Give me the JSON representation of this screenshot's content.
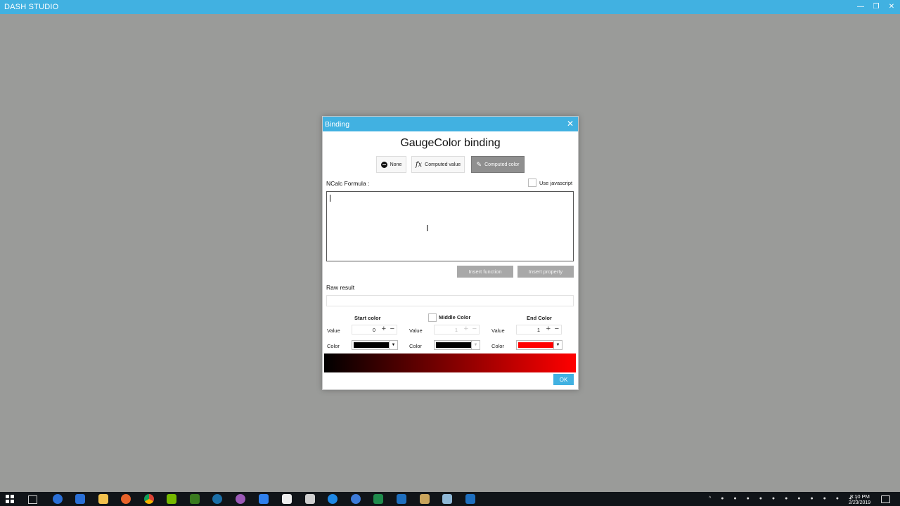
{
  "app": {
    "title": "DASH STUDIO",
    "minimize": "—",
    "maximize": "❐",
    "close": "✕"
  },
  "dialog": {
    "title": "Binding",
    "close": "✕",
    "heading": "GaugeColor binding",
    "modes": [
      {
        "label": "None",
        "icon": "none-icon",
        "active": false
      },
      {
        "label": "Computed value",
        "icon": "fx-icon",
        "active": false
      },
      {
        "label": "Computed color",
        "icon": "brush-icon",
        "active": true
      }
    ],
    "formula_label": "NCalc Formula :",
    "use_javascript_label": "Use javascript",
    "use_javascript_checked": false,
    "formula_value": "",
    "insert_function_label": "Insert function",
    "insert_property_label": "Insert property",
    "raw_result_label": "Raw result",
    "raw_result_value": "",
    "start": {
      "title": "Start color",
      "value_label": "Value",
      "value": "0",
      "color_label": "Color",
      "color": "#000000"
    },
    "middle": {
      "title": "Middle Color",
      "enabled": false,
      "value_label": "Value",
      "value": "1",
      "color_label": "Color",
      "color": "#000000"
    },
    "end": {
      "title": "End Color",
      "value_label": "Value",
      "value": "1",
      "color_label": "Color",
      "color": "#ff0000"
    },
    "ok_label": "OK"
  },
  "taskbar": {
    "time": "8:10 PM",
    "date": "2/23/2019",
    "icons": [
      "windows-start-icon",
      "task-view-icon",
      "edge-icon",
      "store-icon",
      "file-explorer-icon",
      "firefox-icon",
      "chrome-icon",
      "nvidia-icon",
      "nvidia-geforce-icon",
      "steam-icon",
      "app-icon",
      "vs-icon",
      "fox-icon",
      "film-icon",
      "outlook-icon",
      "app2-icon",
      "excel-icon",
      "game-icon",
      "dash-studio-icon",
      "app3-icon"
    ]
  },
  "colors": {
    "accent": "#41b1e1",
    "background": "#9a9b99",
    "active_mode": "#8f8f8f",
    "disabled_button": "#a8a8a8"
  }
}
